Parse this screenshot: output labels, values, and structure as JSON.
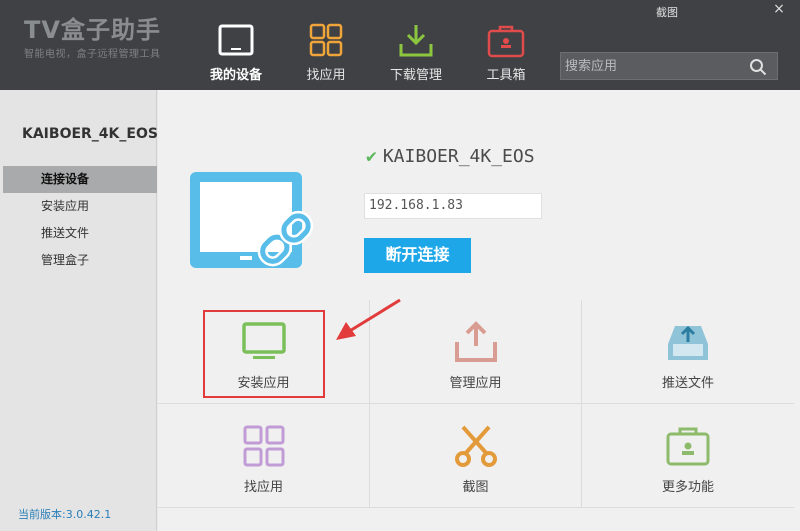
{
  "header": {
    "logo_title": "TV盒子助手",
    "logo_subtitle": "智能电视，盒子远程管理工具",
    "screenshot_label": "截图",
    "close_label": "×",
    "nav": [
      {
        "label": "我的设备",
        "icon": "tv-icon"
      },
      {
        "label": "找应用",
        "icon": "grid-icon"
      },
      {
        "label": "下载管理",
        "icon": "download-icon"
      },
      {
        "label": "工具箱",
        "icon": "toolbox-icon"
      }
    ],
    "search_placeholder": "搜索应用"
  },
  "sidebar": {
    "device_name": "KAIBOER_4K_EOS",
    "items": [
      {
        "label": "连接设备"
      },
      {
        "label": "安装应用"
      },
      {
        "label": "推送文件"
      },
      {
        "label": "管理盒子"
      }
    ],
    "version": "当前版本:3.0.42.1"
  },
  "main": {
    "device_status_name": "KAIBOER_4K_EOS",
    "ip_address": "192.168.1.83",
    "disconnect_label": "断开连接",
    "actions": [
      {
        "label": "安装应用",
        "icon": "monitor-icon",
        "color": "#7bbf5a"
      },
      {
        "label": "管理应用",
        "icon": "upload-icon",
        "color": "#d99c93"
      },
      {
        "label": "推送文件",
        "icon": "inbox-upload-icon",
        "color": "#8fc3d8"
      },
      {
        "label": "找应用",
        "icon": "grid-icon",
        "color": "#c19bd6"
      },
      {
        "label": "截图",
        "icon": "scissors-icon",
        "color": "#e39a3a"
      },
      {
        "label": "更多功能",
        "icon": "briefcase-icon",
        "color": "#8dbb6b"
      }
    ]
  },
  "colors": {
    "header_bg": "#3f4144",
    "accent_blue": "#1ea7e8",
    "highlight_red": "#e23b3b",
    "check_green": "#5cb85c"
  }
}
